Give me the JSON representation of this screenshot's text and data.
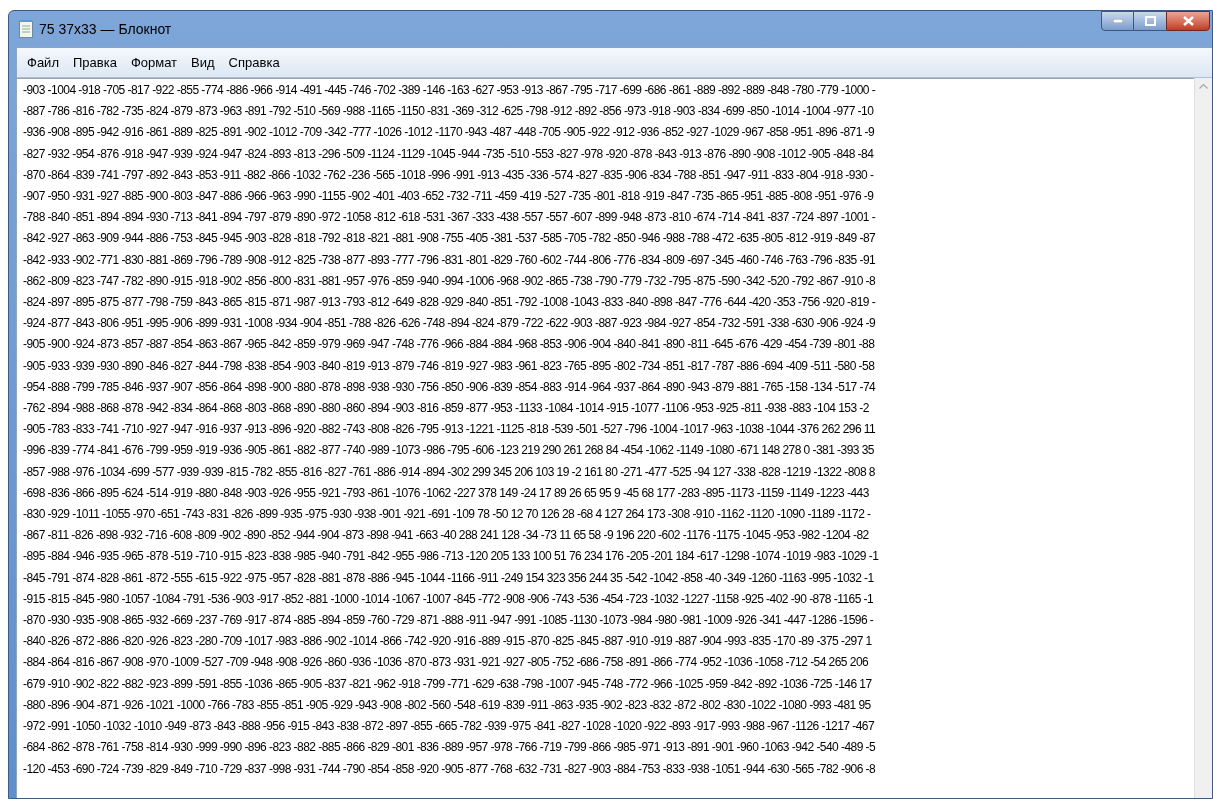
{
  "window": {
    "title": "75 37x33 — Блокнот"
  },
  "menu": [
    {
      "label": "Файл"
    },
    {
      "label": "Правка"
    },
    {
      "label": "Формат"
    },
    {
      "label": "Вид"
    },
    {
      "label": "Справка"
    }
  ],
  "lines": [
    "-903 -1004 -918 -705 -817 -922 -855 -774 -886 -966 -914 -491 -445 -746 -702 -389 -146 -163 -627 -953 -913 -867 -795 -717 -699 -686 -861 -889 -892 -889 -848 -780 -779 -1000 -",
    "-887 -786 -816 -782 -735 -824 -879 -873 -963 -891 -792 -510 -569 -988 -1165 -1150 -831 -369 -312 -625 -798 -912 -892 -856 -973 -918 -903 -834 -699 -850 -1014 -1004 -977 -10",
    "-936 -908 -895 -942 -916 -861 -889 -825 -891 -902 -1012 -709 -342 -777 -1026 -1012 -1170 -943 -487 -448 -705 -905 -922 -912 -936 -852 -927 -1029 -967 -858 -951 -896 -871 -9",
    "-827 -932 -954 -876 -918 -947 -939 -924 -947 -824 -893 -813 -296 -509 -1124 -1129 -1045 -944 -735 -510 -553 -827 -978 -920 -878 -843 -913 -876 -890 -908 -1012 -905 -848 -84",
    "-870 -864 -839 -741 -797 -892 -843 -853 -911 -882 -866 -1032 -762 -236 -565 -1018 -996 -991 -913 -435 -336 -574 -827 -835 -906 -834 -788 -851 -947 -911 -833 -804 -918 -930 -",
    "-907 -950 -931 -927 -885 -900 -803 -847 -886 -966 -963 -990 -1155 -902 -401 -403 -652 -732 -711 -459 -419 -527 -735 -801 -818 -919 -847 -735 -865 -951 -885 -808 -951 -976 -9",
    "-788 -840 -851 -894 -894 -930 -713 -841 -894 -797 -879 -890 -972 -1058 -812 -618 -531 -367 -333 -438 -557 -557 -607 -899 -948 -873 -810 -674 -714 -841 -837 -724 -897 -1001 -",
    "-842 -927 -863 -909 -944 -886 -753 -845 -945 -903 -828 -818 -792 -818 -821 -881 -908 -755 -405 -381 -537 -585 -705 -782 -850 -946 -988 -788 -472 -635 -805 -812 -919 -849 -87",
    "-842 -933 -902 -771 -830 -881 -869 -796 -789 -908 -912 -825 -738 -877 -893 -777 -796 -831 -801 -829 -760 -602 -744 -806 -776 -834 -809 -697 -345 -460 -746 -763 -796 -835 -91",
    "-862 -809 -823 -747 -782 -890 -915 -918 -902 -856 -800 -831 -881 -957 -976 -859 -940 -994 -1006 -968 -902 -865 -738 -790 -779 -732 -795 -875 -590 -342 -520 -792 -867 -910 -8",
    "-824 -897 -895 -875 -877 -798 -759 -843 -865 -815 -871 -987 -913 -793 -812 -649 -828 -929 -840 -851 -792 -1008 -1043 -833 -840 -898 -847 -776 -644 -420 -353 -756 -920 -819 -",
    "-924 -877 -843 -806 -951 -995 -906 -899 -931 -1008 -934 -904 -851 -788 -826 -626 -748 -894 -824 -879 -722 -622 -903 -887 -923 -984 -927 -854 -732 -591 -338 -630 -906 -924 -9",
    "-905 -900 -924 -873 -857 -887 -854 -863 -867 -965 -842 -859 -979 -969 -947 -748 -776 -966 -884 -884 -968 -853 -906 -904 -840 -841 -890 -811 -645 -676 -429 -454 -739 -801 -88",
    "-905 -933 -939 -930 -890 -846 -827 -844 -798 -838 -854 -903 -840 -819 -913 -879 -746 -819 -927 -983 -961 -823 -765 -895 -802 -734 -851 -817 -787 -886 -694 -409 -511 -580 -58",
    "-954 -888 -799 -785 -846 -937 -907 -856 -864 -898 -900 -880 -878 -898 -938 -930 -756 -850 -906 -839 -854 -883 -914 -964 -937 -864 -890 -943 -879 -881 -765 -158 -134 -517 -74",
    "-762 -894 -988 -868 -878 -942 -834 -864 -868 -803 -868 -890 -880 -860 -894 -903 -816 -859 -877 -953 -1133 -1084 -1014 -915 -1077 -1106 -953 -925 -811 -938 -883 -104 153 -2",
    "-905 -783 -833 -741 -710 -927 -947 -916 -937 -913 -896 -920 -882 -743 -808 -826 -795 -913 -1221 -1125 -818 -539 -501 -527 -796 -1004 -1017 -963 -1038 -1044 -376 262 296 11",
    "-996 -839 -774 -841 -676 -799 -959 -919 -936 -905 -861 -882 -877 -740 -989 -1073 -986 -795 -606 -123 219 290 261 268 84 -454 -1062 -1149 -1080 -671 148 278 0 -381 -393 35",
    "-857 -988 -976 -1034 -699 -577 -939 -939 -815 -782 -855 -816 -827 -761 -886 -914 -894 -302 299 345 206 103 19 -2 161 80 -271 -477 -525 -94 127 -338 -828 -1219 -1322 -808 8",
    "-698 -836 -866 -895 -624 -514 -919 -880 -848 -903 -926 -955 -921 -793 -861 -1076 -1062 -227 378 149 -24 17 89 26 65 95 9 -45 68 177 -283 -895 -1173 -1159 -1149 -1223 -443",
    "-830 -929 -1011 -1055 -970 -651 -743 -831 -826 -899 -935 -975 -930 -938 -901 -921 -691 -109 78 -50 12 70 126 28 -68 4 127 264 173 -308 -910 -1162 -1120 -1090 -1189 -1172 -",
    "-867 -811 -826 -898 -932 -716 -608 -809 -902 -890 -852 -944 -904 -873 -898 -941 -663 -40 288 241 128 -34 -73 11 65 58 -9 196 220 -602 -1176 -1175 -1045 -953 -982 -1204 -82",
    "-895 -884 -946 -935 -965 -878 -519 -710 -915 -823 -838 -985 -940 -791 -842 -955 -986 -713 -120 205 133 100 51 76 234 176 -205 -201 184 -617 -1298 -1074 -1019 -983 -1029 -1",
    "-845 -791 -874 -828 -861 -872 -555 -615 -922 -975 -957 -828 -881 -878 -886 -945 -1044 -1166 -911 -249 154 323 356 244 35 -542 -1042 -858 -40 -349 -1260 -1163 -995 -1032 -1",
    "-915 -815 -845 -980 -1057 -1084 -791 -536 -903 -917 -852 -881 -1000 -1014 -1067 -1007 -845 -772 -908 -906 -743 -536 -454 -723 -1032 -1227 -1158 -925 -402 -90 -878 -1165 -1",
    "-870 -930 -935 -908 -865 -932 -669 -237 -769 -917 -874 -885 -894 -859 -760 -729 -871 -888 -911 -947 -991 -1085 -1130 -1073 -984 -980 -981 -1009 -926 -341 -447 -1286 -1596 -",
    "-840 -826 -872 -886 -820 -926 -823 -280 -709 -1017 -983 -886 -902 -1014 -866 -742 -920 -916 -889 -915 -870 -825 -845 -887 -910 -919 -887 -904 -993 -835 -170 -89 -375 -297 1",
    "-884 -864 -816 -867 -908 -970 -1009 -527 -709 -948 -908 -926 -860 -936 -1036 -870 -873 -931 -921 -927 -805 -752 -686 -758 -891 -866 -774 -952 -1036 -1058 -712 -54 265 206",
    "-679 -910 -902 -822 -882 -923 -899 -591 -855 -1036 -865 -905 -837 -821 -962 -918 -799 -771 -629 -638 -798 -1007 -945 -748 -772 -966 -1025 -959 -842 -892 -1036 -725 -146 17",
    "-880 -896 -904 -871 -926 -1021 -1000 -766 -783 -855 -851 -905 -929 -943 -908 -802 -560 -548 -619 -839 -911 -863 -935 -902 -823 -832 -872 -802 -830 -1022 -1080 -993 -481 95",
    "-972 -991 -1050 -1032 -1010 -949 -873 -843 -888 -956 -915 -843 -838 -872 -897 -855 -665 -782 -939 -975 -841 -827 -1028 -1020 -922 -893 -917 -993 -988 -967 -1126 -1217 -467",
    "-684 -862 -878 -761 -758 -814 -930 -999 -990 -896 -823 -882 -885 -866 -829 -801 -836 -889 -957 -978 -766 -719 -799 -866 -985 -971 -913 -891 -901 -960 -1063 -942 -540 -489 -5",
    "-120 -453 -690 -724 -739 -829 -849 -710 -729 -837 -998 -931 -744 -790 -854 -858 -920 -905 -877 -768 -632 -731 -827 -903 -884 -753 -833 -938 -1051 -944 -630 -565 -782 -906 -8"
  ]
}
